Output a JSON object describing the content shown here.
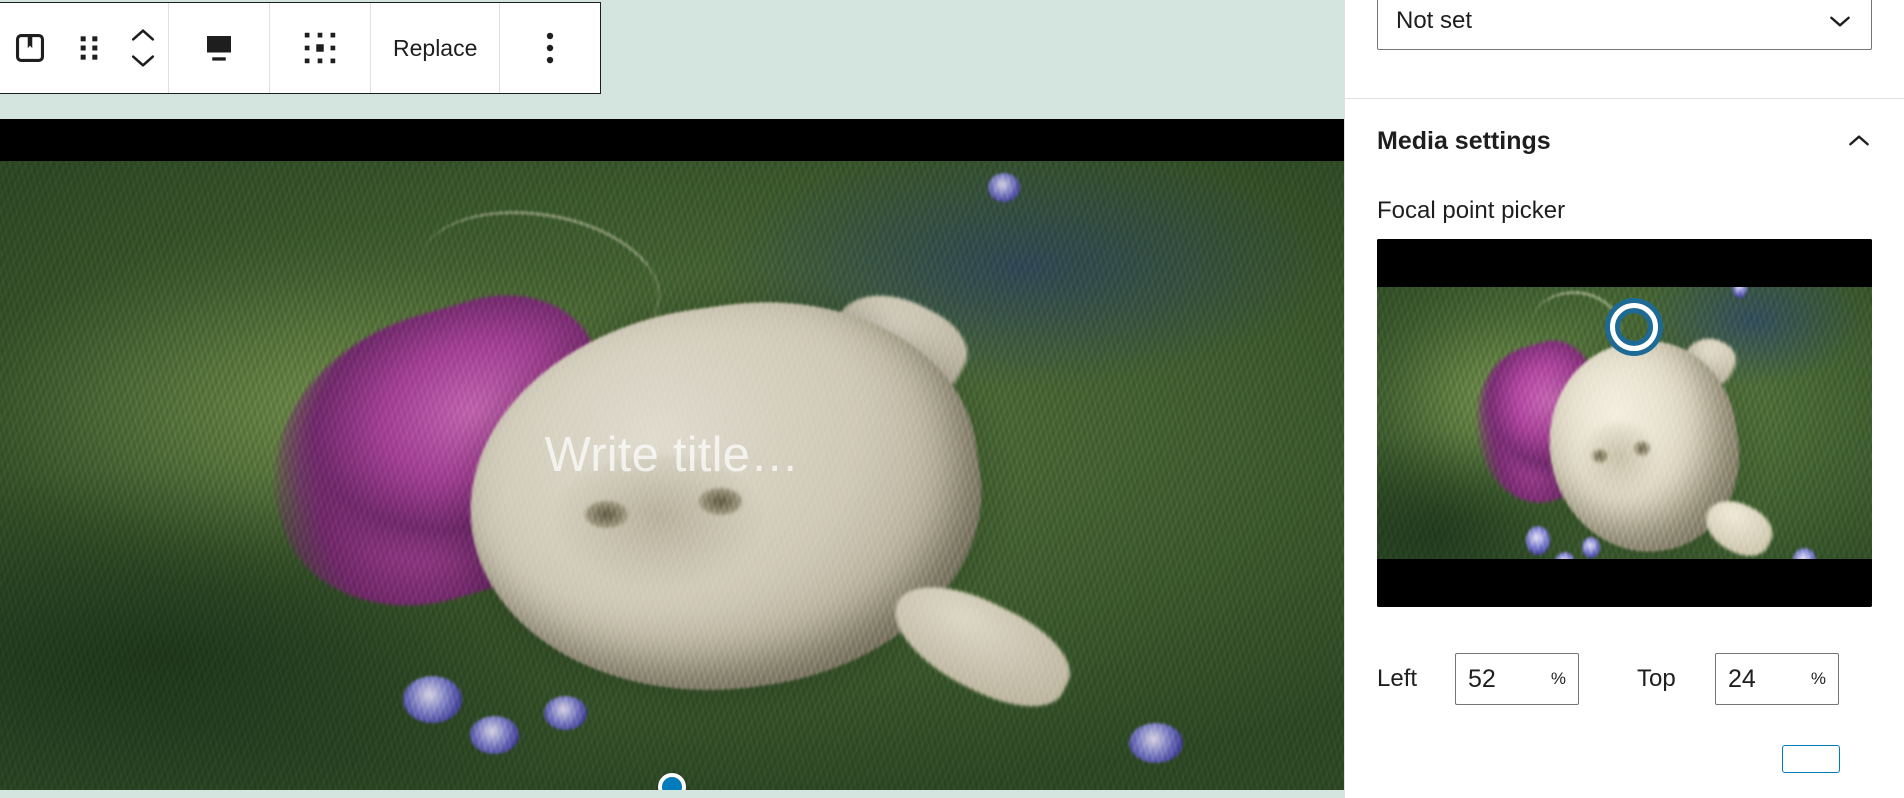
{
  "editor": {
    "background_color": "#d4e5df",
    "toolbar": {
      "groups": [
        {
          "buttons": [
            {
              "name": "block-type-cover",
              "icon": "cover-block-icon",
              "label": "Cover"
            },
            {
              "name": "drag-handle",
              "icon": "drag-dots-icon",
              "label": "Drag"
            },
            {
              "name": "move-updown",
              "icon": "chevron-up-down-icon",
              "label": "Move up or down"
            }
          ]
        },
        {
          "buttons": [
            {
              "name": "align-button",
              "icon": "align-full-width-icon",
              "label": "Align"
            }
          ]
        },
        {
          "buttons": [
            {
              "name": "content-position-button",
              "icon": "content-position-grid-icon",
              "label": "Change content position"
            }
          ]
        },
        {
          "buttons": [
            {
              "name": "replace-button",
              "icon": "",
              "label": "Replace"
            }
          ]
        },
        {
          "buttons": [
            {
              "name": "more-options-button",
              "icon": "more-vertical-icon",
              "label": "Options"
            }
          ]
        }
      ]
    },
    "cover_block": {
      "title_placeholder": "Write title…",
      "resize_handle": "drag-to-resize-handle",
      "overlay_color": "#000000"
    }
  },
  "sidebar": {
    "dimensions_select": {
      "value": "Not set",
      "chevron": "chevron-down-icon"
    },
    "media_settings": {
      "title": "Media settings",
      "toggle_icon": "chevron-up-icon",
      "expanded": true,
      "focal_point_picker": {
        "label": "Focal point picker",
        "marker_color": "#1d6a96",
        "left": {
          "label": "Left",
          "value": "52",
          "unit": "%"
        },
        "top": {
          "label": "Top",
          "value": "24",
          "unit": "%"
        }
      }
    },
    "footer": {
      "button_label": "",
      "accent_color": "#007cba"
    }
  }
}
